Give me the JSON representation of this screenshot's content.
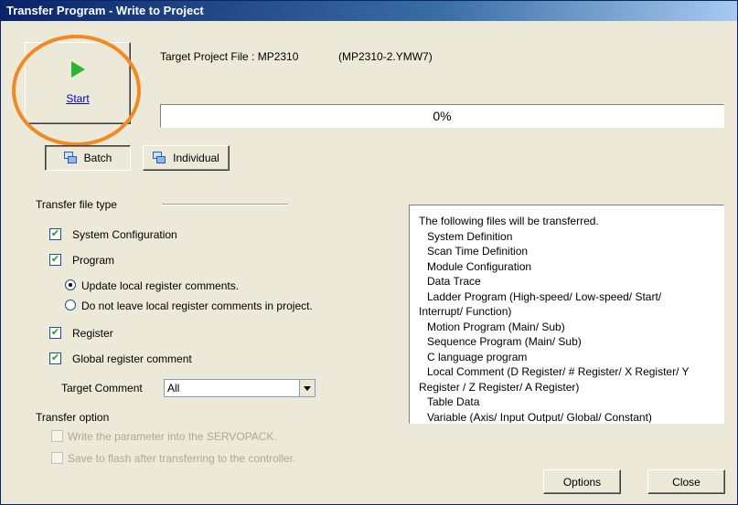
{
  "window": {
    "title": "Transfer Program - Write to Project"
  },
  "start_button": {
    "label": "Start",
    "icon": "play-icon",
    "icon_color": "#2fb52f"
  },
  "target": {
    "label": "Target Project File : MP2310",
    "file": "(MP2310-2.YMW7)"
  },
  "progress": {
    "text": "0%",
    "value": 0
  },
  "mode": {
    "batch_label": "Batch",
    "individual_label": "Individual",
    "selected": "Batch"
  },
  "transfer_file_type": {
    "heading": "Transfer file type",
    "system_configuration": {
      "label": "System Configuration",
      "checked": true
    },
    "program": {
      "label": "Program",
      "checked": true
    },
    "radio_update": {
      "label": "Update local register comments.",
      "selected": true
    },
    "radio_no_leave": {
      "label": "Do not leave local register comments in project.",
      "selected": false
    },
    "register": {
      "label": "Register",
      "checked": true
    },
    "global_comment": {
      "label": "Global register comment",
      "checked": true
    },
    "target_comment": {
      "label": "Target Comment",
      "value": "All"
    }
  },
  "transfer_option": {
    "heading": "Transfer option",
    "write_parameter": {
      "label": "Write the parameter into the SERVOPACK.",
      "checked": false
    },
    "save_flash": {
      "label": "Save to flash after transferring to the controller.",
      "checked": false
    }
  },
  "file_list": {
    "lines": [
      "The following files will be transferred.",
      "System Definition",
      "Scan Time Definition",
      "Module Configuration",
      "Data Trace",
      "Ladder Program (High-speed/ Low-speed/ Start/",
      "Interrupt/ Function)",
      "Motion Program (Main/ Sub)",
      "Sequence Program (Main/ Sub)",
      "C language program",
      "Local Comment (D Register/ # Register/ X Register/ Y",
      "Register / Z Register/ A Register)",
      "Table Data",
      "Variable (Axis/ Input Output/ Global/ Constant)"
    ]
  },
  "buttons": {
    "options": "Options",
    "close": "Close"
  },
  "annotation": {
    "color": "#f08a24"
  }
}
